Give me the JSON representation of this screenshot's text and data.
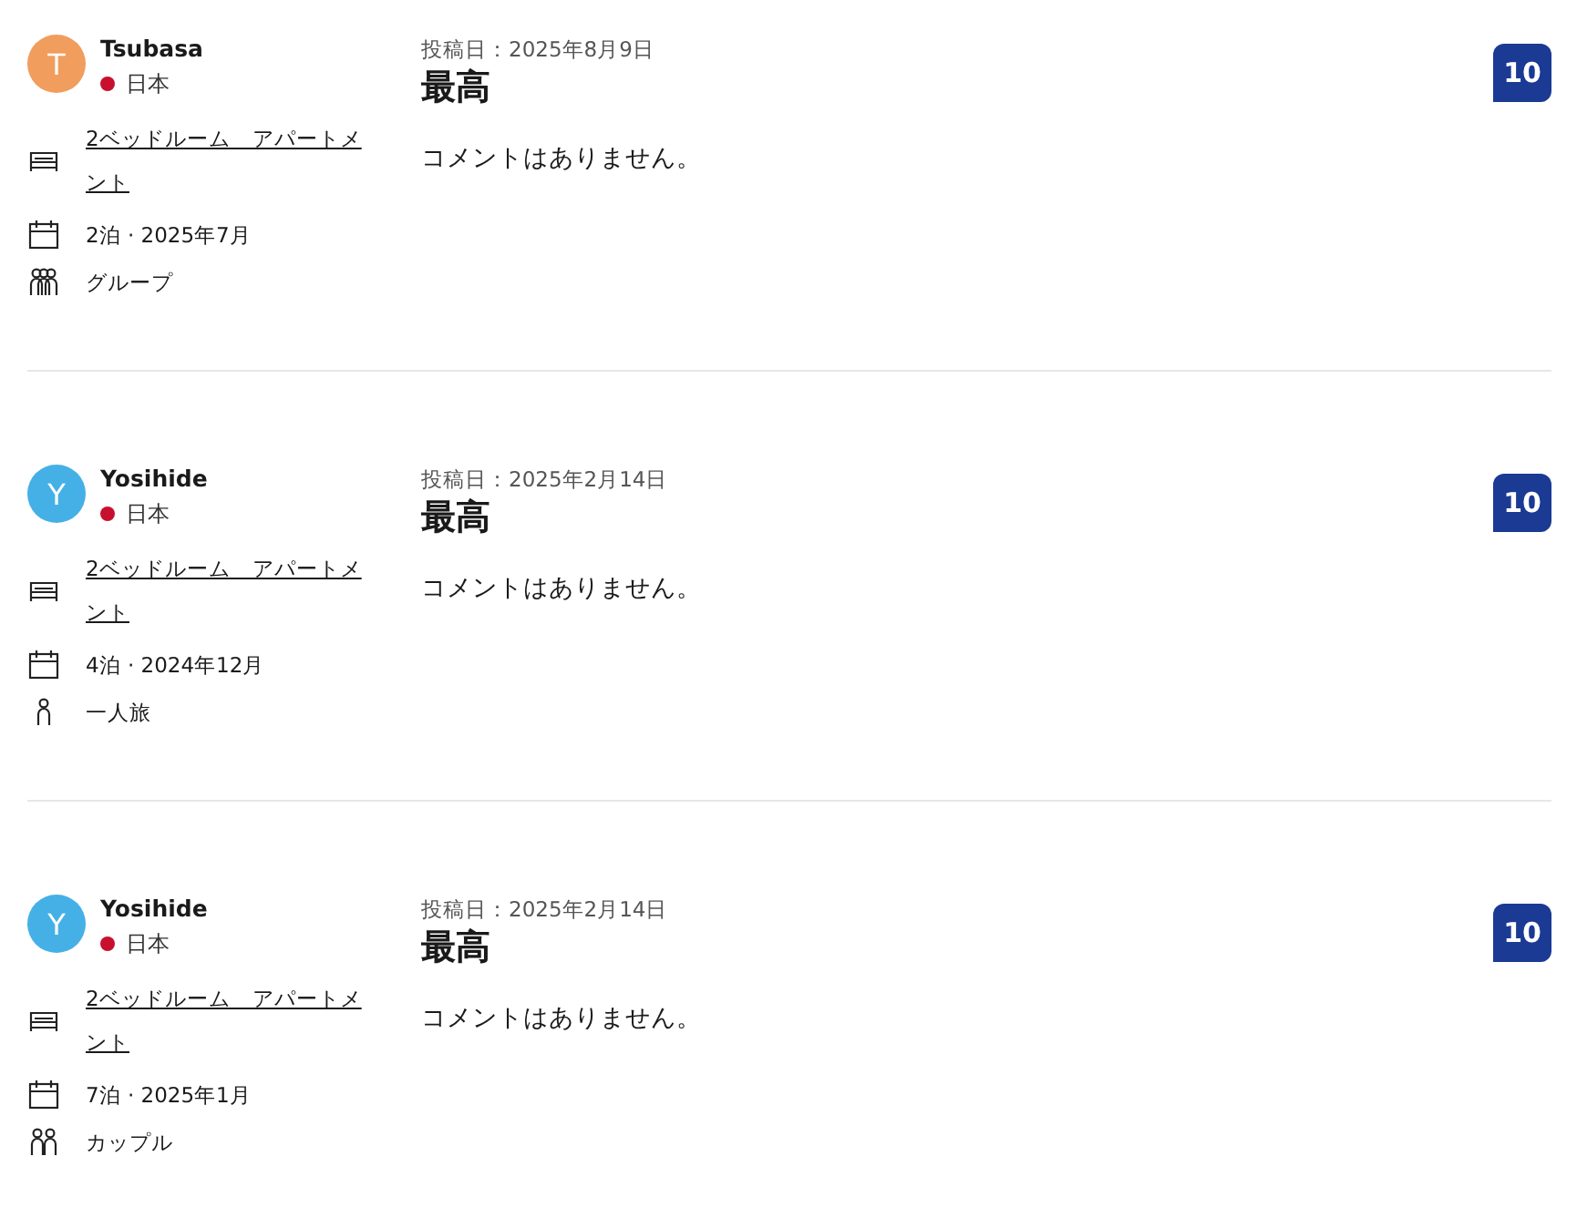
{
  "reviews": [
    {
      "avatar": {
        "initial": "T",
        "color": "#f09d5d"
      },
      "name": "Tsubasa",
      "country": "日本",
      "room": "2ベッドルーム　アパートメント",
      "stay": "2泊 · 2025年7月",
      "traveler": {
        "kind": "group",
        "label": "グループ"
      },
      "posted": "投稿日：2025年8月9日",
      "title": "最高",
      "comment": "コメントはありません。",
      "score": "10"
    },
    {
      "avatar": {
        "initial": "Y",
        "color": "#45b0e6"
      },
      "name": "Yosihide",
      "country": "日本",
      "room": "2ベッドルーム　アパートメント",
      "stay": "4泊 · 2024年12月",
      "traveler": {
        "kind": "solo",
        "label": "一人旅"
      },
      "posted": "投稿日：2025年2月14日",
      "title": "最高",
      "comment": "コメントはありません。",
      "score": "10"
    },
    {
      "avatar": {
        "initial": "Y",
        "color": "#45b0e6"
      },
      "name": "Yosihide",
      "country": "日本",
      "room": "2ベッドルーム　アパートメント",
      "stay": "7泊 · 2025年1月",
      "traveler": {
        "kind": "couple",
        "label": "カップル"
      },
      "posted": "投稿日：2025年2月14日",
      "title": "最高",
      "comment": "コメントはありません。",
      "score": "10"
    }
  ]
}
